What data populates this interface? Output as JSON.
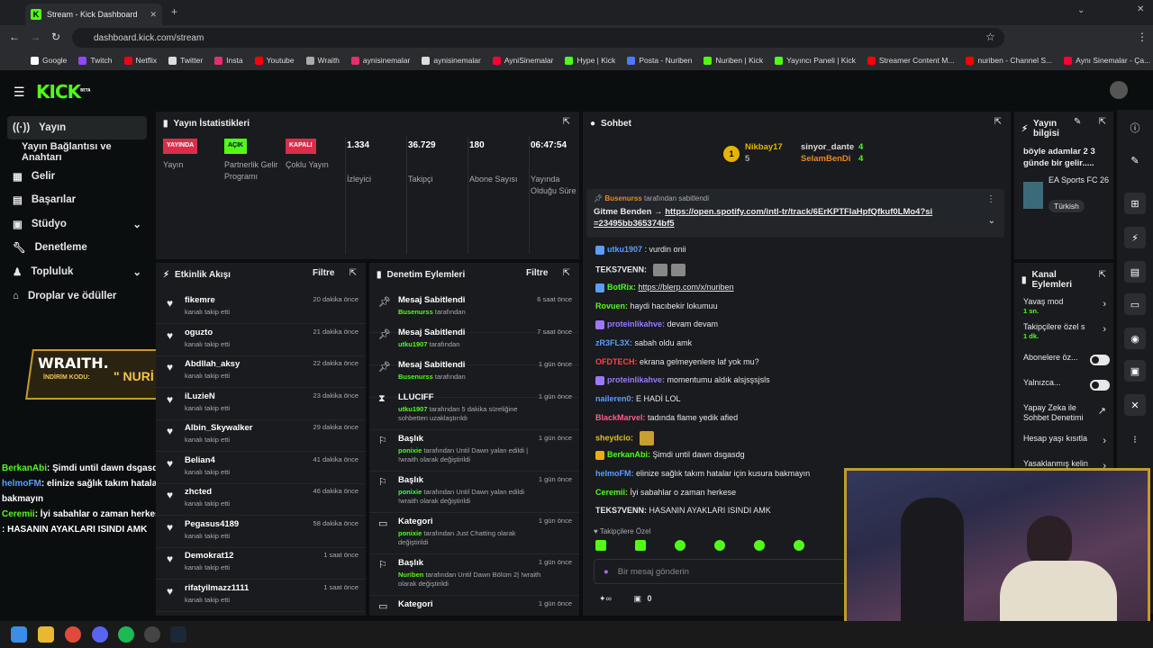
{
  "browser": {
    "tab_title": "Stream - Kick Dashboard",
    "url": "dashboard.kick.com/stream",
    "bookmarks": [
      "Google",
      "Twitch",
      "Netflix",
      "Twitter",
      "Insta",
      "Youtube",
      "Wraith",
      "aynisinemalar",
      "aynisinemalar",
      "AyniSinemalar",
      "Hype | Kick",
      "Posta - Nuriben",
      "Nuriben | Kick",
      "Yayıncı Paneli | Kick",
      "Streamer Content M...",
      "nuriben - Channel S...",
      "Aynı Sinemalar - Ça..."
    ]
  },
  "logo": {
    "text": "KICK",
    "beta": "BETA"
  },
  "sidebar": {
    "items": [
      "Yayın",
      "Yayın Bağlantısı ve Anahtarı",
      "Gelir",
      "Başarılar",
      "Stüdyo",
      "Denetleme",
      "Topluluk",
      "Droplar ve ödüller"
    ]
  },
  "stats": {
    "title": "Yayın İstatistikleri",
    "items": [
      {
        "badge": "YAYINDA",
        "label": "Yayın",
        "color": "#d92e4b"
      },
      {
        "badge": "AÇIK",
        "label": "Partnerlik Gelir Programı",
        "color": "#53fc18"
      },
      {
        "badge": "KAPALI",
        "label": "Çoklu Yayın",
        "color": "#d92e4b"
      },
      {
        "value": "1.334",
        "label": "İzleyici"
      },
      {
        "value": "36.729",
        "label": "Takipçi"
      },
      {
        "value": "180",
        "label": "Abone Sayısı"
      },
      {
        "value": "06:47:54",
        "label": "Yayında Olduğu Süre"
      }
    ]
  },
  "activity": {
    "title": "Etkinlik Akışı",
    "filter": "Filtre",
    "rows": [
      {
        "name": "fikemre",
        "sub": "kanalı takip etti",
        "time": "20 dakika önce"
      },
      {
        "name": "oguzto",
        "sub": "kanalı takip etti",
        "time": "21 dakika önce"
      },
      {
        "name": "Abdllah_aksy",
        "sub": "kanalı takip etti",
        "time": "22 dakika önce"
      },
      {
        "name": "iLuzieN",
        "sub": "kanalı takip etti",
        "time": "23 dakika önce"
      },
      {
        "name": "Albin_Skywalker",
        "sub": "kanalı takip etti",
        "time": "29 dakika önce"
      },
      {
        "name": "Belian4",
        "sub": "kanalı takip etti",
        "time": "41 dakika önce"
      },
      {
        "name": "zhcted",
        "sub": "kanalı takip etti",
        "time": "46 dakika önce"
      },
      {
        "name": "Pegasus4189",
        "sub": "kanalı takip etti",
        "time": "58 dakika önce"
      },
      {
        "name": "Demokrat12",
        "sub": "kanalı takip etti",
        "time": "1 saat önce"
      },
      {
        "name": "rifatyilmazz1111",
        "sub": "kanalı takip etti",
        "time": "1 saat önce"
      }
    ]
  },
  "moderation": {
    "title": "Denetim Eylemleri",
    "filter": "Filtre",
    "rows": [
      {
        "title": "Mesaj Sabitlendi",
        "user": "Busenurss",
        "rest": "tarafından",
        "time": "6 saat önce"
      },
      {
        "title": "Mesaj Sabitlendi",
        "user": "utku1907",
        "rest": "tarafından",
        "time": "7 saat önce"
      },
      {
        "title": "Mesaj Sabitlendi",
        "user": "Busenurss",
        "rest": "tarafından",
        "time": "1 gün önce"
      },
      {
        "title": "LLUCIFF",
        "user": "utku1907",
        "rest": "tarafından 5 dakika süreliğine sohbetten uzaklaştırıldı",
        "time": "1 gün önce"
      },
      {
        "title": "Başlık",
        "user": "ponixie",
        "rest": "tarafından Until Dawn yalan edildi | !wraith olarak değiştirildi",
        "time": "1 gün önce"
      },
      {
        "title": "Başlık",
        "user": "ponixie",
        "rest": "tarafından Until Dawn yalan edildi !wraith olarak değiştirildi",
        "time": "1 gün önce"
      },
      {
        "title": "Kategori",
        "user": "ponixie",
        "rest": "tarafından Just Chatting olarak değiştirildi",
        "time": "1 gün önce"
      },
      {
        "title": "Başlık",
        "user": "Nuriben",
        "rest": "tarafından Until Dawn Bölüm 2| !wraith olarak değiştirildi",
        "time": "1 gün önce"
      },
      {
        "title": "Kategori",
        "user": "",
        "rest": "",
        "time": "1 gün önce"
      }
    ]
  },
  "chat": {
    "title": "Sohbet",
    "leaders": [
      {
        "name": "Nikbay17",
        "count": "5"
      },
      {
        "name": "sinyor_dante",
        "count": "4"
      },
      {
        "name": "SelamBenDi",
        "count": "4"
      }
    ],
    "pinned": {
      "by": "Busenurss",
      "by_rest": "tarafından sabitlendi",
      "text": "Gitme Benden →",
      "link": "https://open.spotify.com/intl-tr/track/6ErKPTFlaHpfQfkuf0LMo4?si=23495bb365374bf5"
    },
    "messages": [
      {
        "user": "utku1907",
        "color": "#5b9dff",
        "text": ": vurdin onii"
      },
      {
        "user": "TEKS7VENN:",
        "color": "#e9eaeb",
        "text": ""
      },
      {
        "user": "BotRix:",
        "color": "#53fc18",
        "text": "https://blerp.com/x/nuriben"
      },
      {
        "user": "Rovuen:",
        "color": "#53fc18",
        "text": "haydi hacıbekir lokumuu"
      },
      {
        "user": "proteinlikahve:",
        "color": "#9b78ff",
        "text": "devam devam"
      },
      {
        "user": "zR3FL3X:",
        "color": "#5b9dff",
        "text": "sabah oldu amk"
      },
      {
        "user": "OFDTECH:",
        "color": "#ff4444",
        "text": "ekrana gelmeyenlere laf yok mu?"
      },
      {
        "user": "proteinlikahve:",
        "color": "#9b78ff",
        "text": "momentumu aldık alsjsşsjsls"
      },
      {
        "user": "naileren0:",
        "color": "#5b9dff",
        "text": "E HADİ LOL"
      },
      {
        "user": "BlackMarvel:",
        "color": "#ff5c8a",
        "text": "tadında flame yedik afied"
      },
      {
        "user": "sheydcio:",
        "color": "#e0c020",
        "text": ""
      },
      {
        "user": "BerkanAbi:",
        "color": "#53fc18",
        "text": "Şimdi until dawn dsgasdg"
      },
      {
        "user": "helmoFM:",
        "color": "#5b9dff",
        "text": "elinize sağlık takım hatalar için kusura bakmayın"
      },
      {
        "user": "Ceremii:",
        "color": "#53fc18",
        "text": "İyi sabahlar o zaman herkese"
      },
      {
        "user": "TEKS7VENN:",
        "color": "#e9eaeb",
        "text": "HASANIN AYAKLARI ISINDI AMK"
      }
    ],
    "followers_only": "Takipçilere Özel",
    "input_placeholder": "Bir mesaj gönderin",
    "points": "0"
  },
  "stream_info": {
    "title": "Yayın bilgisi",
    "text": "böyle adamlar 2 3 günde bir gelir.....",
    "game": "EA Sports FC 26",
    "tag": "Türkish"
  },
  "channel_actions": {
    "title": "Kanal Eylemleri",
    "items": [
      {
        "label": "Yavaş mod",
        "sub": "1 sn."
      },
      {
        "label": "Takipçilere özel s",
        "sub": "1 dk."
      },
      {
        "label": "Abonelere öz...",
        "sub": ""
      },
      {
        "label": "Yalnızca...",
        "sub": ""
      },
      {
        "label": "Yapay Zeka ile Sohbet Denetimi",
        "sub": ""
      },
      {
        "label": "Hesap yaşı kısıtla",
        "sub": ""
      },
      {
        "label": "Yasaklanmış kelin",
        "sub": ""
      }
    ]
  },
  "overlay": {
    "brand": "WRAITH.",
    "code_label": "İNDİRİM KODU:",
    "code": "\" NURİ \"",
    "chat": [
      {
        "user": "BerkanAbi",
        "color": "#53fc18",
        "text": ": Şimdi until dawn dsgasdg"
      },
      {
        "user": "helmoFM",
        "color": "#5b9dff",
        "text": ": elinize sağlık takım hatalar için kusura bakmayın"
      },
      {
        "user": "Ceremii",
        "color": "#53fc18",
        "text": ": İyi sabahlar o zaman herkese"
      },
      {
        "user": "",
        "color": "#fff",
        "text": ": HASANIN AYAKLARI ISINDI AMK"
      }
    ]
  }
}
